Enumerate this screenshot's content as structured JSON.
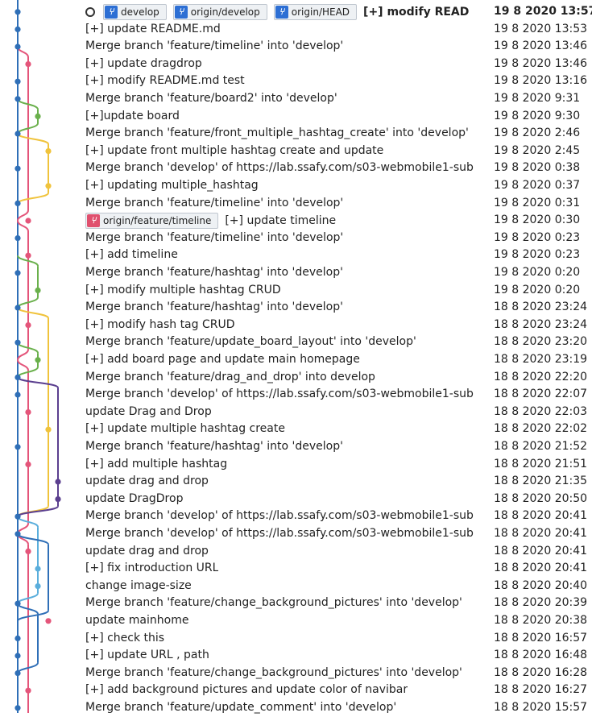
{
  "head_marker": "head-indicator-icon",
  "lane_colors": [
    "#2f6fb7",
    "#e4557a",
    "#6ab04c",
    "#f0c33c",
    "#5b3f8f",
    "#5aaedc",
    "#7a7a7a"
  ],
  "commits": [
    {
      "tags": [
        {
          "label": "develop",
          "color": "blue"
        },
        {
          "label": "origin/develop",
          "color": "blue"
        },
        {
          "label": "origin/HEAD",
          "color": "blue"
        }
      ],
      "message": "[+] modify READ",
      "date": "19 8 2020 13:57",
      "bold": true,
      "head": true
    },
    {
      "message": "[+] update README.md",
      "date": "19 8 2020 13:53"
    },
    {
      "message": "Merge branch 'feature/timeline' into 'develop'",
      "date": "19 8 2020 13:46"
    },
    {
      "message": "[+] update dragdrop",
      "date": "19 8 2020 13:46"
    },
    {
      "message": "[+] modify README.md test",
      "date": "19 8 2020 13:16"
    },
    {
      "message": "Merge branch 'feature/board2' into 'develop'",
      "date": "19 8 2020 9:31"
    },
    {
      "message": "[+]update board",
      "date": "19 8 2020 9:30"
    },
    {
      "message": "Merge branch 'feature/front_multiple_hashtag_create' into 'develop'",
      "date": "19 8 2020 2:46"
    },
    {
      "message": "[+] update front multiple hashtag create and update",
      "date": "19 8 2020 2:45"
    },
    {
      "message": "Merge branch 'develop' of https://lab.ssafy.com/s03-webmobile1-sub",
      "date": "19 8 2020 0:38"
    },
    {
      "message": "[+] updating multiple_hashtag",
      "date": "19 8 2020 0:37"
    },
    {
      "message": "Merge branch 'feature/timeline' into 'develop'",
      "date": "19 8 2020 0:31"
    },
    {
      "tags": [
        {
          "label": "origin/feature/timeline",
          "color": "red"
        }
      ],
      "message": "[+] update timeline",
      "date": "19 8 2020 0:30"
    },
    {
      "message": "Merge branch 'feature/timeline' into 'develop'",
      "date": "19 8 2020 0:23"
    },
    {
      "message": "[+] add timeline",
      "date": "19 8 2020 0:23"
    },
    {
      "message": "Merge branch 'feature/hashtag' into 'develop'",
      "date": "19 8 2020 0:20"
    },
    {
      "message": "[+] modify multiple hashtag CRUD",
      "date": "19 8 2020 0:20"
    },
    {
      "message": "Merge branch 'feature/hashtag' into 'develop'",
      "date": "18 8 2020 23:24"
    },
    {
      "message": "[+] modify hash tag CRUD",
      "date": "18 8 2020 23:24"
    },
    {
      "message": "Merge branch 'feature/update_board_layout' into 'develop'",
      "date": "18 8 2020 23:20"
    },
    {
      "message": "[+] add board page and update main homepage",
      "date": "18 8 2020 23:19"
    },
    {
      "message": "Merge branch 'feature/drag_and_drop' into develop",
      "date": "18 8 2020 22:20"
    },
    {
      "message": "Merge branch 'develop' of https://lab.ssafy.com/s03-webmobile1-sub",
      "date": "18 8 2020 22:07"
    },
    {
      "message": "update Drag and Drop",
      "date": "18 8 2020 22:03"
    },
    {
      "message": "[+] update multiple hashtag create",
      "date": "18 8 2020 22:02"
    },
    {
      "message": "Merge branch 'feature/hashtag' into 'develop'",
      "date": "18 8 2020 21:52"
    },
    {
      "message": "[+] add multiple hashtag",
      "date": "18 8 2020 21:51"
    },
    {
      "message": "update drag and drop",
      "date": "18 8 2020 21:35"
    },
    {
      "message": "update DragDrop",
      "date": "18 8 2020 20:50"
    },
    {
      "message": "Merge branch 'develop' of https://lab.ssafy.com/s03-webmobile1-sub",
      "date": "18 8 2020 20:41"
    },
    {
      "message": "Merge branch 'develop' of https://lab.ssafy.com/s03-webmobile1-sub",
      "date": "18 8 2020 20:41"
    },
    {
      "message": "update drag and drop",
      "date": "18 8 2020 20:41"
    },
    {
      "message": "[+] fix introduction URL",
      "date": "18 8 2020 20:41"
    },
    {
      "message": "change image-size",
      "date": "18 8 2020 20:40"
    },
    {
      "message": "Merge branch 'feature/change_background_pictures' into 'develop'",
      "date": "18 8 2020 20:39"
    },
    {
      "message": "update mainhome",
      "date": "18 8 2020 20:38"
    },
    {
      "message": "[+] check this",
      "date": "18 8 2020 16:57"
    },
    {
      "message": "[+] update URL , path",
      "date": "18 8 2020 16:48"
    },
    {
      "message": "Merge branch 'feature/change_background_pictures' into 'develop'",
      "date": "18 8 2020 16:28"
    },
    {
      "message": "[+] add background pictures and update color of navibar",
      "date": "18 8 2020 16:27"
    },
    {
      "message": "Merge branch 'feature/update_comment' into 'develop'",
      "date": "18 8 2020 15:57"
    }
  ]
}
